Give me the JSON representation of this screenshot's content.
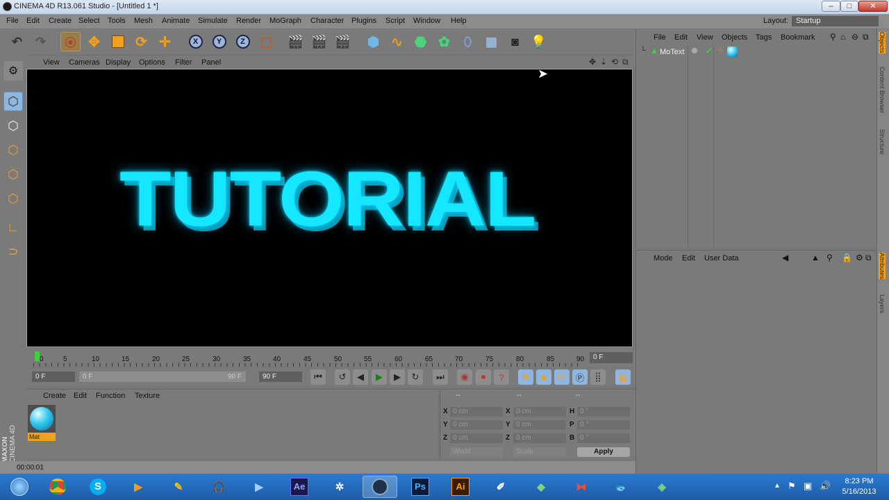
{
  "window": {
    "title": "CINEMA 4D R13.061 Studio - [Untitled 1 *]",
    "controls": [
      "–",
      "□",
      "✕"
    ]
  },
  "menubar": {
    "items": [
      "File",
      "Edit",
      "Create",
      "Select",
      "Tools",
      "Mesh",
      "Animate",
      "Simulate",
      "Render",
      "MoGraph",
      "Character",
      "Plugins",
      "Script",
      "Window",
      "Help"
    ],
    "layout_label": "Layout:",
    "layout_value": "Startup"
  },
  "toolbar": {
    "axis_x": "X",
    "axis_y": "Y",
    "axis_z": "Z"
  },
  "viewport": {
    "menu": [
      "View",
      "Cameras",
      "Display",
      "Options",
      "Filter",
      "Panel"
    ],
    "scene_text": "TUTORIAL",
    "text_color": "#14e7ff"
  },
  "timeline": {
    "ticks": [
      "0",
      "5",
      "10",
      "15",
      "20",
      "25",
      "30",
      "35",
      "40",
      "45",
      "50",
      "55",
      "60",
      "65",
      "70",
      "75",
      "80",
      "85",
      "90"
    ],
    "current_frame": "0 F"
  },
  "transport": {
    "start_frame": "0 F",
    "range_start": "0 F",
    "range_end": "90 F",
    "end_frame": "90 F"
  },
  "material_manager": {
    "menu": [
      "Create",
      "Edit",
      "Function",
      "Texture"
    ],
    "material_name": "Mat"
  },
  "coordinates": {
    "headers": [
      "--",
      "--",
      "--"
    ],
    "rows": [
      {
        "l1": "X",
        "v1": "0 cm",
        "l2": "X",
        "v2": "0 cm",
        "l3": "H",
        "v3": "0 °"
      },
      {
        "l1": "Y",
        "v1": "0 cm",
        "l2": "Y",
        "v2": "0 cm",
        "l3": "P",
        "v3": "0 °"
      },
      {
        "l1": "Z",
        "v1": "0 cm",
        "l2": "Z",
        "v2": "0 cm",
        "l3": "B",
        "v3": "0 °"
      }
    ],
    "mode_world": "World",
    "mode_scale": "Scale",
    "apply_label": "Apply"
  },
  "status_bar": {
    "time": "00:00:01"
  },
  "object_manager": {
    "menu": [
      "File",
      "Edit",
      "View",
      "Objects",
      "Tags",
      "Bookmark"
    ],
    "object_name": "MoText"
  },
  "attributes": {
    "menu": [
      "Mode",
      "Edit",
      "User Data"
    ]
  },
  "side_tabs": [
    "Objects",
    "Content Browser",
    "Structure",
    "Attributes",
    "Layers"
  ],
  "branding": {
    "maxon": "MAXON",
    "product": "CINEMA 4D"
  },
  "taskbar": {
    "apps": [
      "Start",
      "Chrome",
      "Skype",
      "Media Player",
      "Media",
      "Headphones",
      "Player",
      "Ae",
      "Network",
      "Cinema 4D",
      "Ps",
      "Ai",
      "Tools",
      "Cube",
      "Bow",
      "Fish",
      "Cinema"
    ],
    "time": "8:23 PM",
    "date": "5/16/2013"
  }
}
